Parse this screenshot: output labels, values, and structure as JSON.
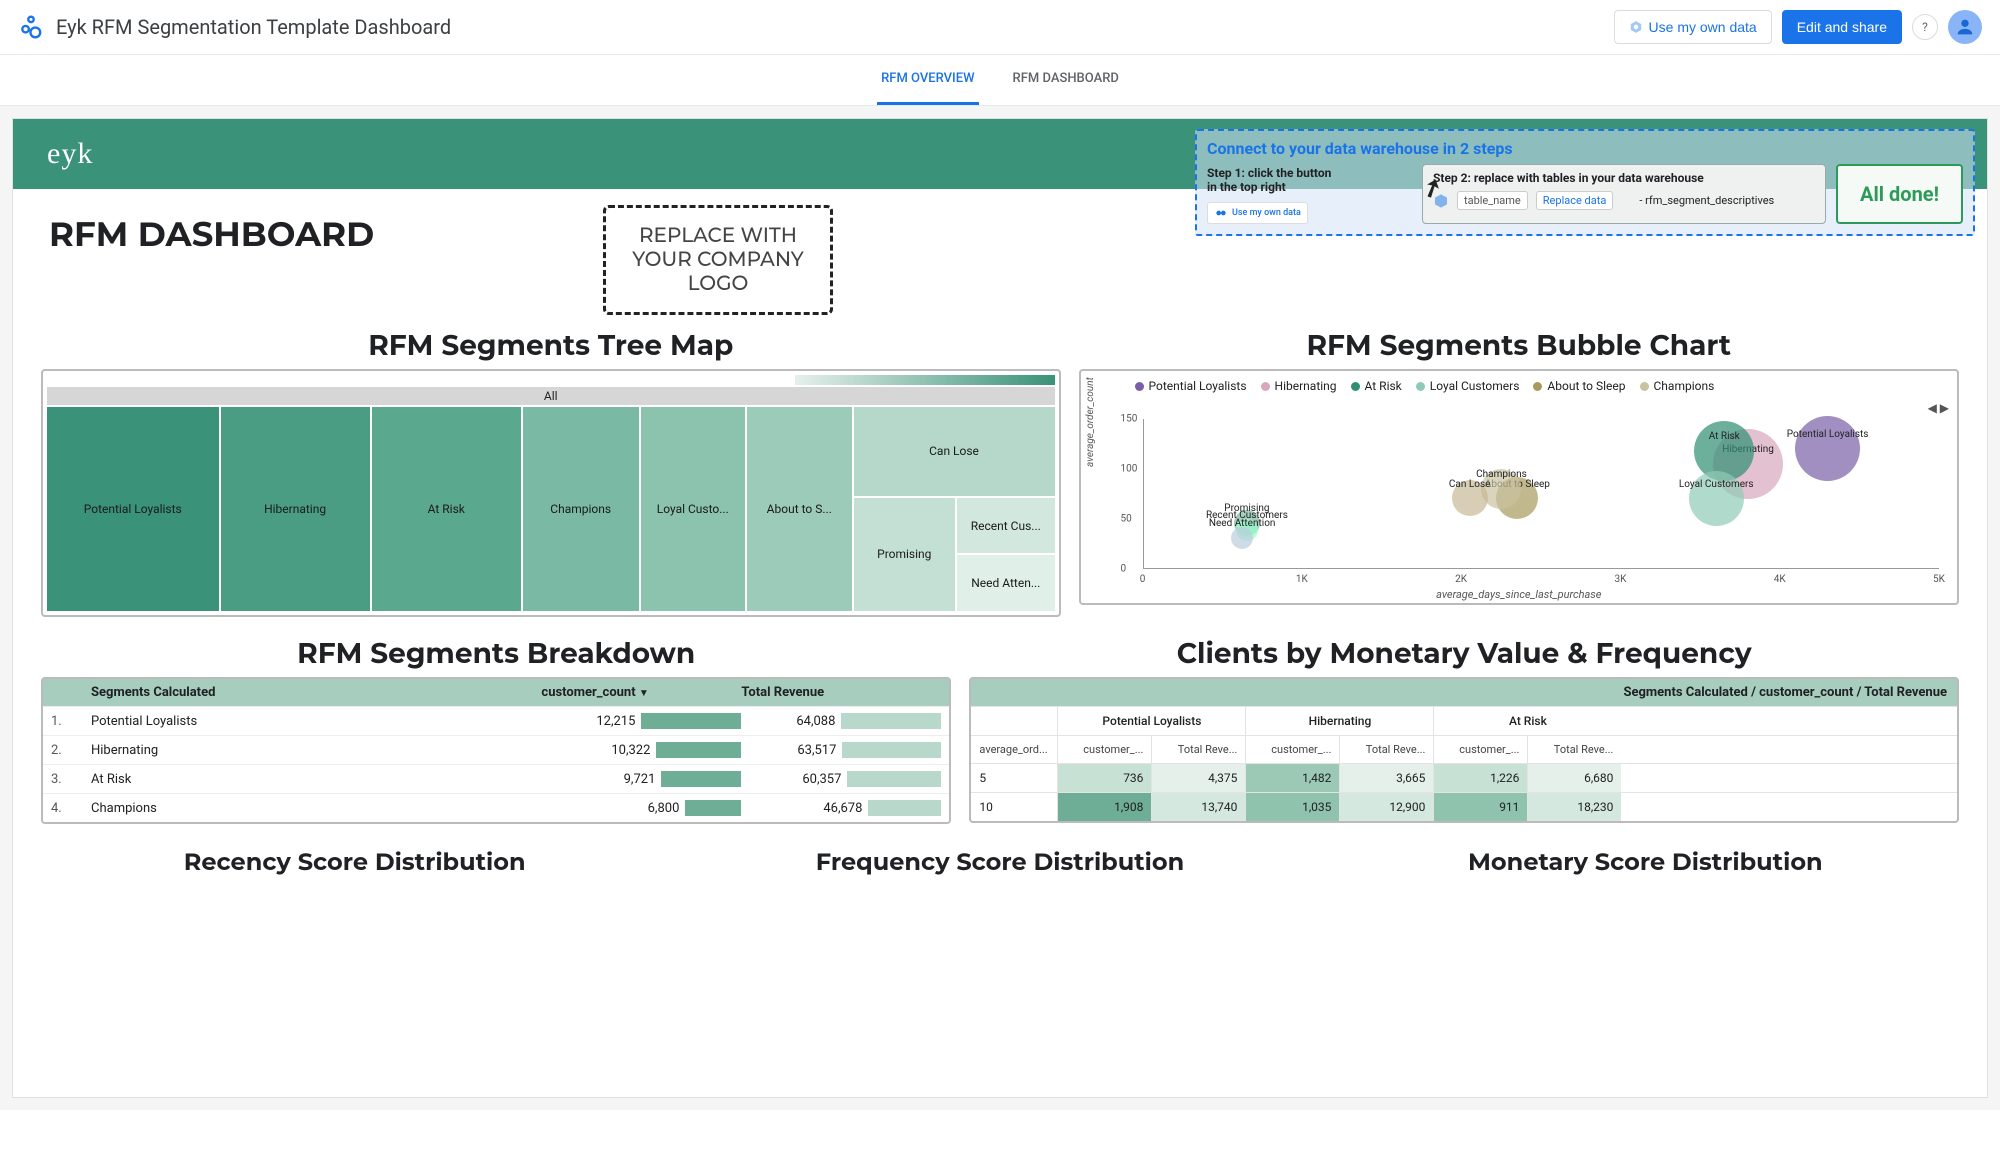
{
  "header": {
    "title": "Eyk RFM Segmentation Template Dashboard",
    "use_own_data": "Use my own data",
    "edit_share": "Edit and share"
  },
  "tabs": {
    "overview": "RFM OVERVIEW",
    "dashboard": "RFM DASHBOARD"
  },
  "banner": {
    "logo": "eyk"
  },
  "connect": {
    "title": "Connect to your data warehouse in 2 steps",
    "step1_l1": "Step 1: click the button",
    "step1_l2": "in the top right",
    "step1_chip": "Use my own data",
    "step2_hdr": "Step 2: replace with tables in your data warehouse",
    "step2_tag1": "table_name",
    "step2_tag2": "Replace data",
    "step2_desc": "- rfm_segment_descriptives",
    "done": "All done!"
  },
  "page_title": "RFM DASHBOARD",
  "logo_placeholder": "REPLACE WITH YOUR COMPANY LOGO",
  "treemap": {
    "title": "RFM Segments Tree Map",
    "all": "All"
  },
  "bubble": {
    "title": "RFM Segments Bubble Chart",
    "ylab": "average_order_count",
    "xlab": "average_days_since_last_purchase",
    "legend": [
      "Potential Loyalists",
      "Hibernating",
      "At Risk",
      "Loyal Customers",
      "About to Sleep",
      "Champions"
    ]
  },
  "breakdown": {
    "title": "RFM Segments Breakdown",
    "h_seg": "Segments Calculated",
    "h_count": "customer_count",
    "h_rev": "Total Revenue"
  },
  "pivot": {
    "title": "Clients by Monetary Value & Frequency",
    "hdr": "Segments Calculated / customer_count / Total Revenue",
    "rowlab": "average_ord...",
    "col_c": "customer_...",
    "col_r": "Total Reve...",
    "seg1": "Potential Loyalists",
    "seg2": "Hibernating",
    "seg3": "At Risk"
  },
  "dist": {
    "r": "Recency Score Distribution",
    "f": "Frequency Score Distribution",
    "m": "Monetary Score Distribution"
  },
  "chart_data": {
    "treemap": {
      "type": "treemap",
      "root": "All",
      "items": [
        {
          "name": "Potential Loyalists",
          "value": 12215,
          "color": "#3a9278"
        },
        {
          "name": "Hibernating",
          "value": 10322,
          "color": "#4a9d83"
        },
        {
          "name": "At Risk",
          "value": 9721,
          "color": "#5aa88e"
        },
        {
          "name": "Champions",
          "value": 6800,
          "color": "#7ab9a3"
        },
        {
          "name": "Loyal Custo...",
          "value": 5600,
          "color": "#8bc3af"
        },
        {
          "name": "About to S...",
          "value": 4900,
          "color": "#9ccbb9"
        },
        {
          "name": "Can Lose",
          "value": 3200,
          "color": "#b5d8ca"
        },
        {
          "name": "Promising",
          "value": 2400,
          "color": "#c4e0d4"
        },
        {
          "name": "Recent Cus...",
          "value": 1800,
          "color": "#d2e8de"
        },
        {
          "name": "Need Atten...",
          "value": 1500,
          "color": "#e0efe7"
        }
      ]
    },
    "bubble": {
      "type": "scatter",
      "xlabel": "average_days_since_last_purchase",
      "ylabel": "average_order_count",
      "xlim": [
        0,
        5000
      ],
      "ylim": [
        0,
        150
      ],
      "xticks": [
        0,
        1000,
        2000,
        3000,
        4000,
        5000
      ],
      "xtick_labels": [
        "0",
        "1K",
        "2K",
        "3K",
        "4K",
        "5K"
      ],
      "yticks": [
        0,
        50,
        100,
        150
      ],
      "series": [
        {
          "name": "Potential Loyalists",
          "x": 4300,
          "y": 120,
          "size": 65,
          "color": "#7a5fa8"
        },
        {
          "name": "Hibernating",
          "x": 3800,
          "y": 105,
          "size": 70,
          "color": "#d9a7bd"
        },
        {
          "name": "At Risk",
          "x": 3650,
          "y": 118,
          "size": 60,
          "color": "#2e8f72"
        },
        {
          "name": "Loyal Customers",
          "x": 3600,
          "y": 70,
          "size": 55,
          "color": "#8fcab6"
        },
        {
          "name": "About to Sleep",
          "x": 2350,
          "y": 70,
          "size": 42,
          "color": "#a89a5e"
        },
        {
          "name": "Champions",
          "x": 2250,
          "y": 80,
          "size": 40,
          "color": "#c9c2a0"
        },
        {
          "name": "Can Lose",
          "x": 2050,
          "y": 70,
          "size": 36,
          "color": "#c8b896"
        },
        {
          "name": "Promising",
          "x": 650,
          "y": 45,
          "size": 26,
          "color": "#7fb9a2"
        },
        {
          "name": "Recent Customers",
          "x": 650,
          "y": 38,
          "size": 22,
          "color": "#9fc"
        },
        {
          "name": "Need Attention",
          "x": 620,
          "y": 30,
          "size": 22,
          "color": "#bcd"
        }
      ]
    },
    "breakdown": {
      "type": "table",
      "columns": [
        "Segments Calculated",
        "customer_count",
        "Total Revenue"
      ],
      "rows": [
        {
          "rank": "1.",
          "segment": "Potential Loyalists",
          "customer_count": "12,215",
          "revenue": "64,088",
          "cbar": 100,
          "rbar": 100
        },
        {
          "rank": "2.",
          "segment": "Hibernating",
          "customer_count": "10,322",
          "revenue": "63,517",
          "cbar": 85,
          "rbar": 99
        },
        {
          "rank": "3.",
          "segment": "At Risk",
          "customer_count": "9,721",
          "revenue": "60,357",
          "cbar": 80,
          "rbar": 94
        },
        {
          "rank": "4.",
          "segment": "Champions",
          "customer_count": "6,800",
          "revenue": "46,678",
          "cbar": 56,
          "rbar": 73
        }
      ]
    },
    "pivot": {
      "type": "table",
      "row_field": "average_order_count_bucket",
      "col_field": "Segments Calculated",
      "metrics": [
        "customer_count",
        "Total Revenue"
      ],
      "segments": [
        "Potential Loyalists",
        "Hibernating",
        "At Risk"
      ],
      "rows": [
        {
          "bucket": "5",
          "cells": [
            {
              "c": "736",
              "r": "4,375"
            },
            {
              "c": "1,482",
              "r": "3,665"
            },
            {
              "c": "1,226",
              "r": "6,680"
            }
          ]
        },
        {
          "bucket": "10",
          "cells": [
            {
              "c": "1,908",
              "r": "13,740"
            },
            {
              "c": "1,035",
              "r": "12,900"
            },
            {
              "c": "911",
              "r": "18,230"
            }
          ]
        }
      ]
    }
  }
}
